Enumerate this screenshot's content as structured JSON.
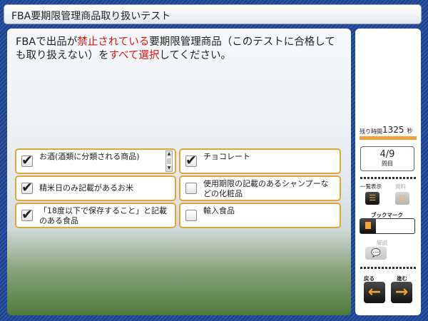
{
  "title": "FBA要期限管理商品取り扱いテスト",
  "question": {
    "part1": "FBAで出品が",
    "part2": "禁止されている",
    "part3": "要期限管理商品（このテストに合格しても取り扱えない）を",
    "part4": "すべて選択",
    "part5": "してください。"
  },
  "options": [
    {
      "label": "お酒(酒類に分類される商品)",
      "checked": true
    },
    {
      "label": "チョコレート",
      "checked": true
    },
    {
      "label": "精米日のみ記載があるお米",
      "checked": true
    },
    {
      "label": "使用期限の記載のあるシャンプーなどの化粧品",
      "checked": false
    },
    {
      "label": "「18度以下で保存すること」と記載のある食品",
      "checked": true
    },
    {
      "label": "輸入食品",
      "checked": false
    }
  ],
  "check_mark": "✔",
  "sidebar": {
    "time_label": "残り時間",
    "time_value": "1325",
    "time_unit": "秒",
    "progress": "4/9",
    "progress_label": "問目",
    "list_label": "一覧表示",
    "material_label": "資料",
    "bookmark_label": "ブックマーク",
    "explain_label": "解説",
    "back_label": "戻る",
    "next_label": "進む",
    "back_arrow": "←",
    "next_arrow": "→"
  },
  "colors": {
    "accent": "#f2a23a",
    "highlight": "#dd1111",
    "frame": "#2c57a8"
  }
}
